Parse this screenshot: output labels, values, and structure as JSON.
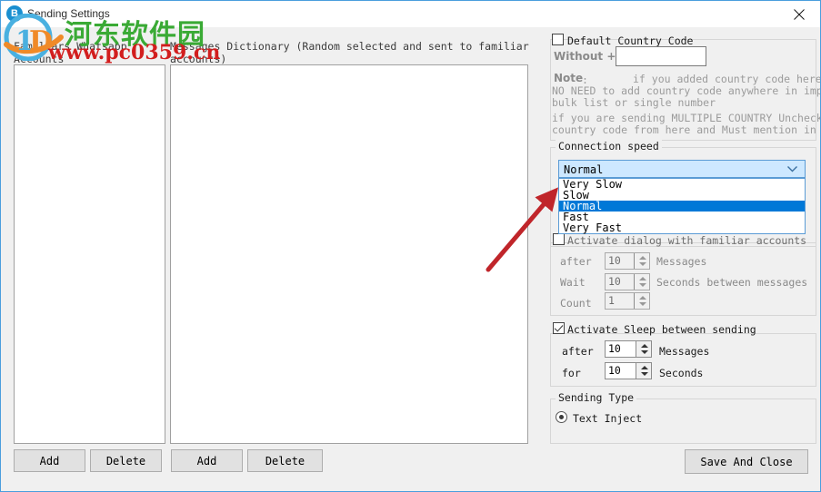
{
  "window": {
    "title": "Sending Settings",
    "icon": "app-b-icon",
    "close_label": "close-icon",
    "accent_border": "#4a9edd"
  },
  "watermark": {
    "chinese": "河东软件园",
    "url": "www.pc0359.cn",
    "chinese_color": "#3aaa35",
    "url_color": "#d21e1e"
  },
  "left_panel": {
    "label": "Familiars Whatsapp\nAccounts",
    "add_label": "Add",
    "delete_label": "Delete"
  },
  "middle_panel": {
    "label": "Messages Dictionary  (Random selected and sent to familiar\naccounts)",
    "add_label": "Add",
    "delete_label": "Delete"
  },
  "country_code": {
    "checkbox_label": "Default Country Code",
    "checked": false,
    "without_label": "Without +",
    "input_value": "",
    "note_bold": "Note",
    "note_colon": ":",
    "note_line1": "if you added country code here",
    "note_line2": "NO NEED to add country code anywhere in importing",
    "note_line3": " bulk list or single number",
    "note_line4": "if you are sending MULTIPLE COUNTRY Uncheck",
    "note_line5": "country code from here and Must mention in your im"
  },
  "connection_speed": {
    "group_title": "Connection speed",
    "selected": "Normal",
    "options": [
      "Very Slow",
      "Slow",
      "Normal",
      "Fast",
      "Very Fast"
    ],
    "dropdown_open": true,
    "highlight_color": "#0078d7",
    "combo_bg": "#cde8ff"
  },
  "activate_dialog": {
    "checkbox_label": "Activate dialog with familiar accounts",
    "checked": false,
    "enabled": false,
    "rows": [
      {
        "label": "after",
        "value": "10",
        "unit": "Messages"
      },
      {
        "label": "Wait",
        "value": "10",
        "unit": "Seconds between messages"
      },
      {
        "label": "Count",
        "value": "1",
        "unit": ""
      }
    ]
  },
  "activate_sleep": {
    "checkbox_label": "Activate Sleep between sending",
    "checked": true,
    "enabled": true,
    "rows": [
      {
        "label": "after",
        "value": "10",
        "unit": "Messages"
      },
      {
        "label": "for",
        "value": "10",
        "unit": "Seconds"
      }
    ]
  },
  "sending_type": {
    "group_title": "Sending Type",
    "option_label": "Text Inject",
    "selected": true
  },
  "footer": {
    "save_label": "Save And Close"
  },
  "annotation": {
    "arrow_color": "#c0252a",
    "points_to": "connection-speed-dropdown"
  }
}
